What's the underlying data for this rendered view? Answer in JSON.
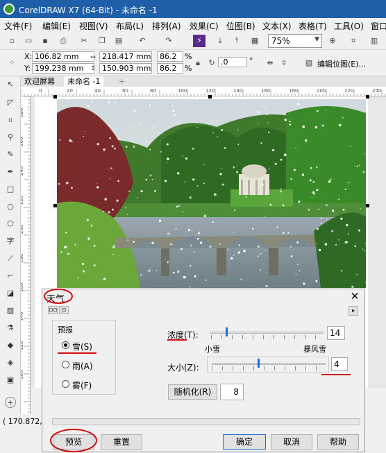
{
  "window": {
    "title": "CorelDRAW X7 (64-Bit) - 未命名 -1"
  },
  "menu": [
    "文件(F)",
    "编辑(E)",
    "视图(V)",
    "布局(L)",
    "排列(A)",
    "效果(C)",
    "位图(B)",
    "文本(X)",
    "表格(T)",
    "工具(O)",
    "窗口"
  ],
  "toolbar": {
    "zoom": "75%"
  },
  "propbar": {
    "x_label": "X:",
    "x": "106.82 mm",
    "y_label": "Y:",
    "y": "199.238 mm",
    "w": "218.417 mm",
    "h": "150.903 mm",
    "scale_w": "86.2",
    "scale_h": "86.2",
    "pct": "%",
    "rotation": ".0",
    "deg": "°",
    "edit_bitmap": "编辑位图(E)..."
  },
  "doctabs": {
    "welcome": "欢迎屏幕",
    "doc": "未命名 -1",
    "add": "+"
  },
  "ruler": {
    "top": [
      "0",
      "20",
      "40",
      "60",
      "80",
      "100",
      "120",
      "140",
      "160",
      "180",
      "200",
      "220",
      "240"
    ],
    "left": [
      "280",
      "260",
      "240",
      "220",
      "200",
      "180",
      "160",
      "140",
      "120",
      "100"
    ]
  },
  "status": {
    "coords": "( 170.872, 2"
  },
  "dialog": {
    "title": "天气",
    "close": "✕",
    "forecast_group": "预报",
    "options": [
      "雪(S)",
      "雨(A)",
      "雾(F)"
    ],
    "selected": 0,
    "density_label": "浓度(T):",
    "density_value": "14",
    "density_level": 14,
    "min_label": "小雪",
    "max_label": "暴风雪",
    "size_label": "大小(Z):",
    "size_value": "4",
    "size_level": 4,
    "randomize": "随机化(R)",
    "seed": "8",
    "buttons": {
      "preview": "预览",
      "reset": "重置",
      "ok": "确定",
      "cancel": "取消",
      "help": "帮助"
    }
  },
  "colors": {
    "titlebar": "#1f5fa8",
    "accent": "#1a6fd0",
    "annotation": "#d01010"
  }
}
